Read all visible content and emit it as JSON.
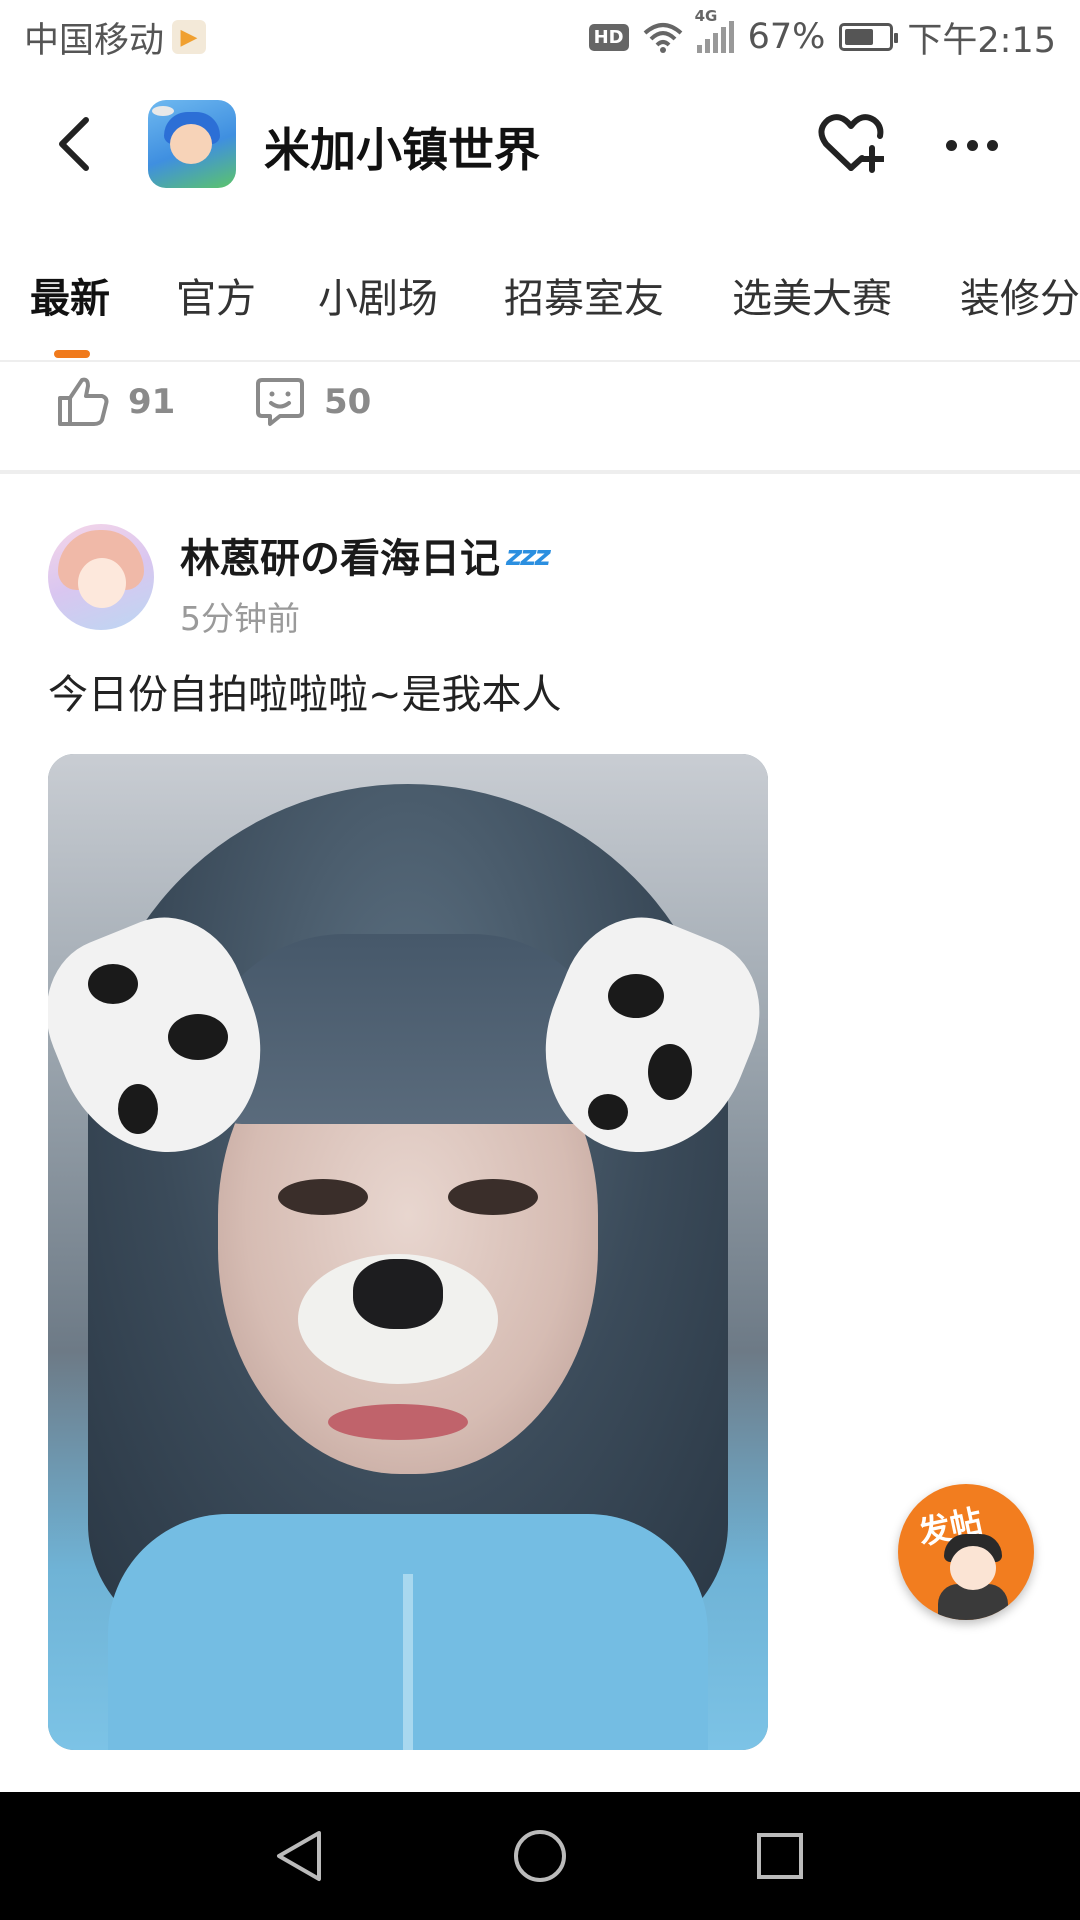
{
  "status_bar": {
    "carrier": "中国移动",
    "hd": "HD",
    "network": "4G",
    "battery_percent": "67%",
    "battery_level": 0.67,
    "time": "下午2:15"
  },
  "header": {
    "title": "米加小镇世界"
  },
  "tabs": [
    {
      "label": "最新",
      "active": true
    },
    {
      "label": "官方",
      "active": false
    },
    {
      "label": "小剧场",
      "active": false
    },
    {
      "label": "招募室友",
      "active": false
    },
    {
      "label": "选美大赛",
      "active": false
    },
    {
      "label": "装修分",
      "active": false
    }
  ],
  "previous_post": {
    "likes": "91",
    "comments": "50"
  },
  "post": {
    "username": "林蒽研の看海日记",
    "username_suffix": "zzz",
    "time": "5分钟前",
    "text": "今日份自拍啦啦啦~是我本人"
  },
  "fab": {
    "label": "发帖"
  },
  "colors": {
    "accent": "#f07a1c",
    "fab": "#f27d1f",
    "muted": "#9a9a9a"
  },
  "icons": {
    "back": "chevron-left-icon",
    "follow": "heart-plus-icon",
    "more": "more-dots-icon",
    "like": "thumb-up-icon",
    "comment": "comment-smile-icon"
  }
}
